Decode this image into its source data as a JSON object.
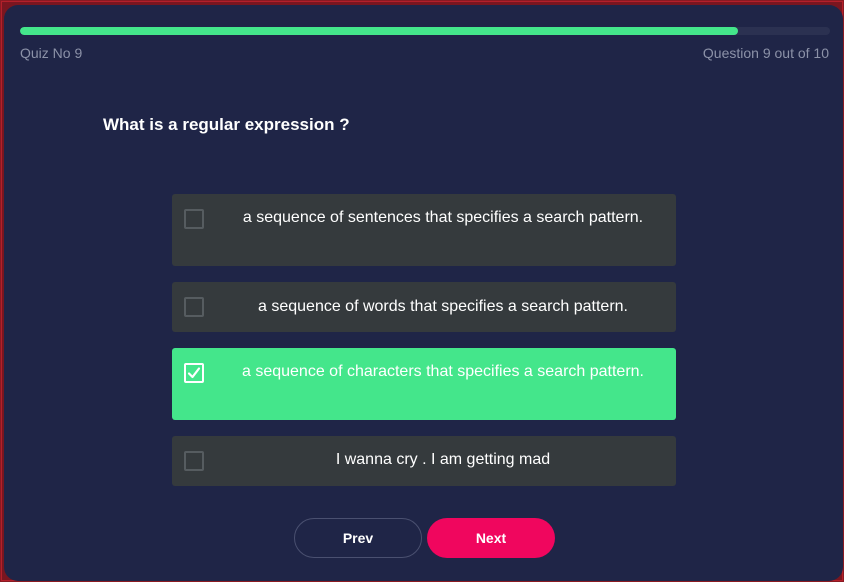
{
  "header": {
    "quiz_label": "Quiz No 9",
    "question_counter": "Question 9 out of 10",
    "progress_fraction": 0.887
  },
  "question": {
    "text": "What is a regular expression ?"
  },
  "options": [
    {
      "label": "a sequence of sentences that specifies a search pattern.",
      "checked": false
    },
    {
      "label": "a sequence of words that specifies a search pattern.",
      "checked": false
    },
    {
      "label": "a sequence of characters that specifies a search pattern.",
      "checked": true
    },
    {
      "label": "I wanna cry . I am getting mad",
      "checked": false
    }
  ],
  "buttons": {
    "prev_label": "Prev",
    "next_label": "Next"
  },
  "colors": {
    "background": "#1f2547",
    "accent_green": "#44e68b",
    "option_bg": "#353a3d",
    "next_button": "#f0065e",
    "outer_border": "#b3202b"
  }
}
